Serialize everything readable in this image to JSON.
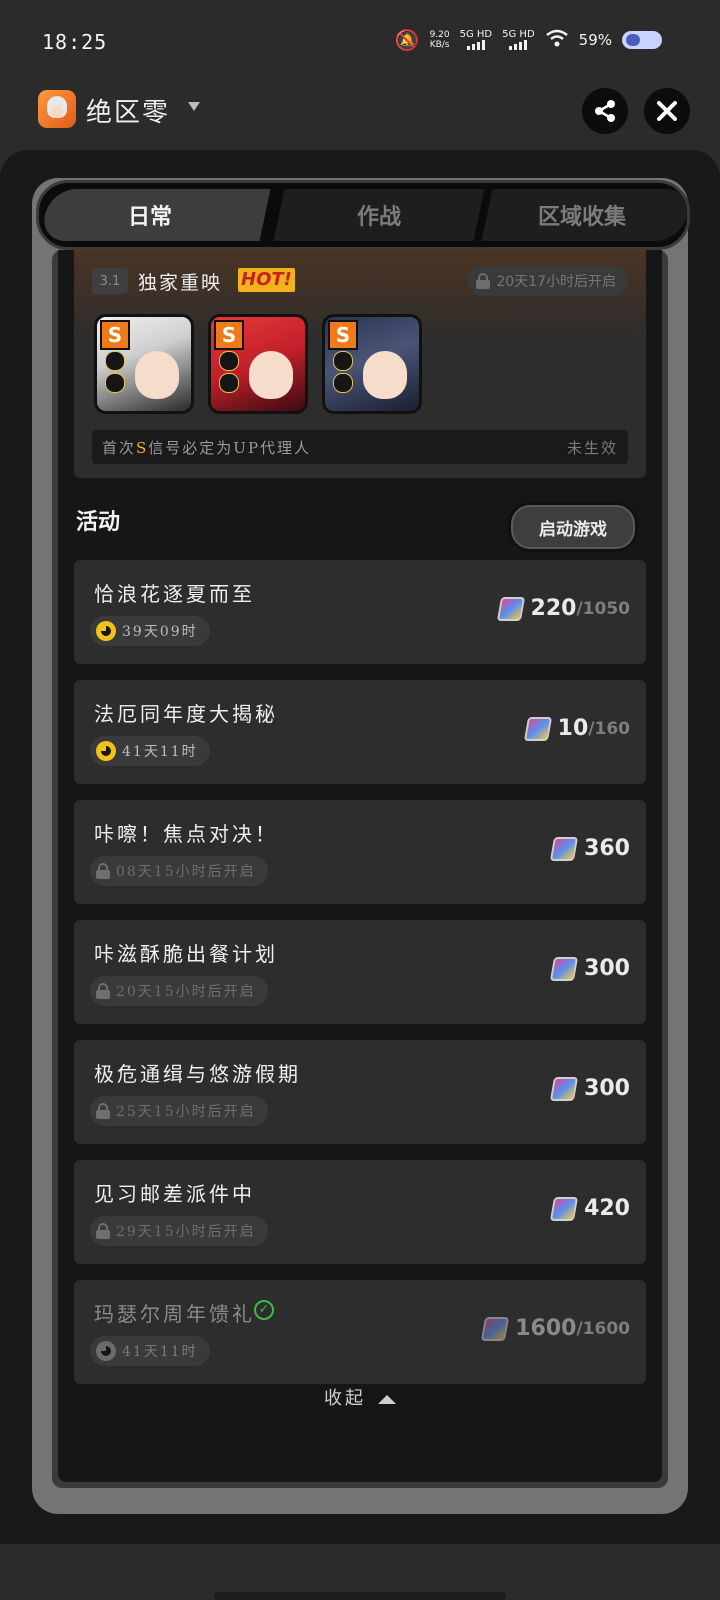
{
  "status": {
    "time": "18:25",
    "speed_value": "9.20",
    "speed_unit": "KB/s",
    "net1": "5G HD",
    "net2": "5G HD",
    "battery": "59%"
  },
  "app": {
    "title": "绝区零"
  },
  "tabs": [
    {
      "label": "日常"
    },
    {
      "label": "作战"
    },
    {
      "label": "区域收集"
    }
  ],
  "banner": {
    "version": "3.1",
    "title": "独家重映",
    "hot": "HOT!",
    "lock_text": "20天17小时后开启",
    "rank_label": "S",
    "footer_left_pre": "首次",
    "footer_left_s": "S",
    "footer_left_post": "信号必定为UP代理人",
    "footer_right": "未生效"
  },
  "section": {
    "title": "活动",
    "start_button": "启动游戏"
  },
  "activities": [
    {
      "name": "恰浪花逐夏而至",
      "time": "39天09时",
      "reward": "220",
      "total": "/1050"
    },
    {
      "name": "法厄同年度大揭秘",
      "time": "41天11时",
      "reward": "10",
      "total": "/160"
    },
    {
      "name": "咔嚓！焦点对决！",
      "time": "08天15小时后开启",
      "reward": "360",
      "total": ""
    },
    {
      "name": "咔滋酥脆出餐计划",
      "time": "20天15小时后开启",
      "reward": "300",
      "total": ""
    },
    {
      "name": "极危通缉与悠游假期",
      "time": "25天15小时后开启",
      "reward": "300",
      "total": ""
    },
    {
      "name": "见习邮差派件中",
      "time": "29天15小时后开启",
      "reward": "420",
      "total": ""
    },
    {
      "name": "玛瑟尔周年馈礼",
      "time": "41天11时",
      "reward": "1600",
      "total": "/1600"
    }
  ],
  "collapse_label": "收起",
  "colors": {
    "accent_hot": "#f2b21c",
    "rank_orange": "#f07a1a",
    "check_green": "#3fb84a"
  }
}
